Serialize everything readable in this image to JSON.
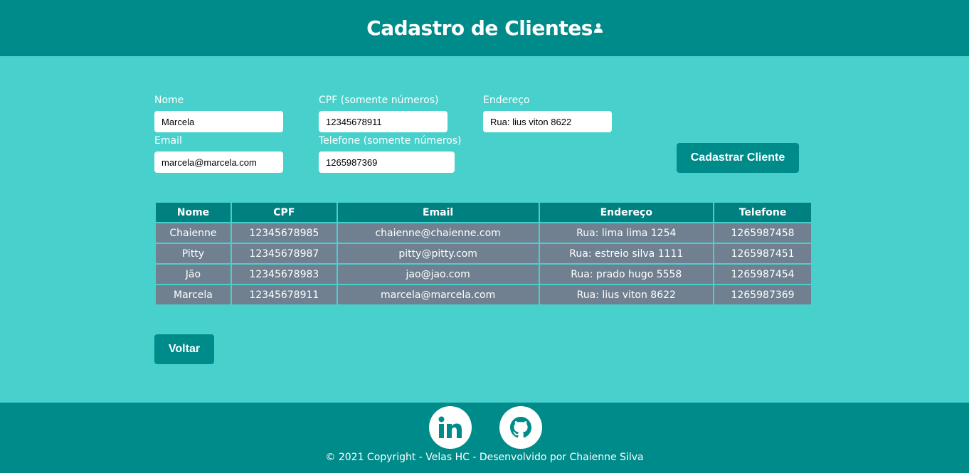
{
  "header": {
    "title": "Cadastro de Clientes"
  },
  "form": {
    "nome": {
      "label": "Nome",
      "value": "Marcela"
    },
    "cpf": {
      "label": "CPF (somente números)",
      "value": "12345678911"
    },
    "endereco": {
      "label": "Endereço",
      "value": "Rua: lius viton 8622"
    },
    "email": {
      "label": "Email",
      "value": "marcela@marcela.com"
    },
    "telefone": {
      "label": "Telefone (somente números)",
      "value": "1265987369"
    },
    "submit_label": "Cadastrar Cliente"
  },
  "table": {
    "headers": [
      "Nome",
      "CPF",
      "Email",
      "Endereço",
      "Telefone"
    ],
    "rows": [
      [
        "Chaienne",
        "12345678985",
        "chaienne@chaienne.com",
        "Rua: lima lima 1254",
        "1265987458"
      ],
      [
        "Pitty",
        "12345678987",
        "pitty@pitty.com",
        "Rua: estreio silva 1111",
        "1265987451"
      ],
      [
        "Jão",
        "12345678983",
        "jao@jao.com",
        "Rua: prado hugo 5558",
        "1265987454"
      ],
      [
        "Marcela",
        "12345678911",
        "marcela@marcela.com",
        "Rua: lius viton 8622",
        "1265987369"
      ]
    ]
  },
  "back_label": "Voltar",
  "footer": {
    "icons": [
      "linkedin-icon",
      "github-icon"
    ],
    "copyright": "© 2021 Copyright - Velas HC - Desenvolvido por Chaienne Silva"
  },
  "colors": {
    "background": "#48d1cc",
    "header": "#008b8b",
    "table_header": "#008080",
    "table_cell": "#708090"
  }
}
